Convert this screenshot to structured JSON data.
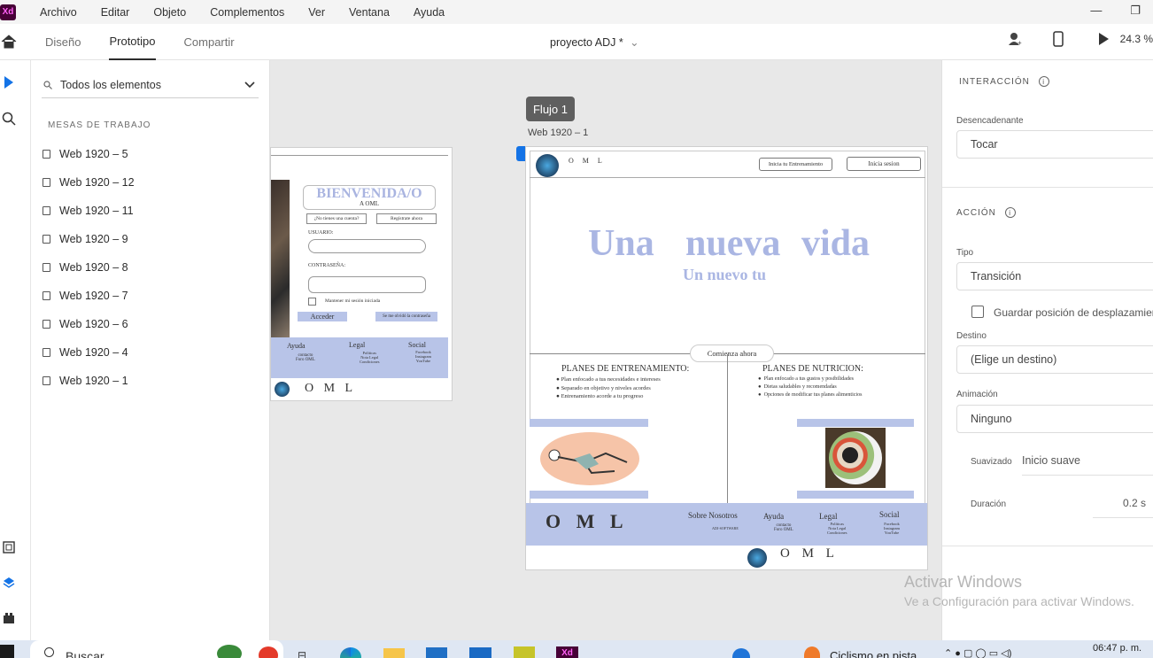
{
  "app": {
    "logo": "Xd",
    "menu": [
      "Archivo",
      "Editar",
      "Objeto",
      "Complementos",
      "Ver",
      "Ventana",
      "Ayuda"
    ]
  },
  "toolbar": {
    "tabs": [
      "Diseño",
      "Prototipo",
      "Compartir"
    ],
    "doc_title": "proyecto ADJ *",
    "zoom": "24.3 %"
  },
  "layers": {
    "search_label": "Todos los elementos",
    "section": "MESAS DE TRABAJO",
    "artboards": [
      "Web 1920 – 5",
      "Web 1920 – 12",
      "Web 1920 – 11",
      "Web 1920 – 9",
      "Web 1920 – 8",
      "Web 1920 – 7",
      "Web 1920 – 6",
      "Web 1920 – 4",
      "Web 1920 – 1"
    ]
  },
  "canvas": {
    "flow_label": "Flujo 1",
    "ab_label": "Web 1920 – 1",
    "login": {
      "welcome": "BIENVENIDA/O",
      "sub": "A OML",
      "no_account": "¿No tienes una cuenta?",
      "register": "Regístrate ahora",
      "user": "USUARIO:",
      "pass": "CONTRASEÑA:",
      "keep": "Mantener mi sesión iniciada",
      "access": "Acceder",
      "forgot": "Se me olvidó la contraseña",
      "footer_ayuda": "Ayuda",
      "footer_ayuda_items": "contacto\nForo OML",
      "footer_legal": "Legal",
      "footer_legal_items": "Políticas\nNota Legal\nCondiciones",
      "footer_social": "Social",
      "footer_social_items": "Facebook\nInstagram\nYouTube",
      "brand": "O M L"
    },
    "home": {
      "logo_text": "O M L",
      "btn1": "Inicia tu Entrenamiento",
      "btn2": "Inicia sesion",
      "hero1": "Una",
      "hero2": "nueva",
      "hero3": "vida",
      "hero_sub": "Un nuevo tu",
      "cta": "Comienza ahora",
      "plan1_title": "PLANES DE ENTRENAMIENTO:",
      "plan1_items": [
        "Plan enfocado a tus necesidades e intereses",
        "Separado en objetivo y  niveles acordes",
        "Entrenamiento acorde a tu progreso"
      ],
      "plan2_title": "PLANES DE NUTRICION:",
      "plan2_items": [
        "Plan enfocado a tus gustos y posibilidades",
        "Dietas saludables y recomendadas",
        "Opciones de modificar tus planes alimenticios"
      ],
      "footer_brand": "O M L",
      "about": "Sobre Nosotros",
      "about_sub": "ADJ-SOFTWARE",
      "ayuda": "Ayuda",
      "ayuda_items": "contacto\nForo OML",
      "legal": "Legal",
      "legal_items": "Políticas\nNota Legal\nCondiciones",
      "social": "Social",
      "social_items": "Facebook\nInstagram\nYouTube",
      "bottom_brand": "O M L"
    }
  },
  "props": {
    "interaction": "INTERACCIÓN",
    "trigger_label": "Desencadenante",
    "trigger_value": "Tocar",
    "action": "ACCIÓN",
    "type_label": "Tipo",
    "type_value": "Transición",
    "preserve": "Guardar posición de desplazamiento",
    "dest_label": "Destino",
    "dest_value": "(Elige un destino)",
    "anim_label": "Animación",
    "anim_value": "Ninguno",
    "ease_label": "Suavizado",
    "ease_value": "Inicio suave",
    "dur_label": "Duración",
    "dur_value": "0.2 s"
  },
  "watermark": {
    "line1": "Activar Windows",
    "line2": "Ve a Configuración para activar Windows."
  },
  "taskbar": {
    "search": "Buscar",
    "music": "Ciclismo en pista",
    "time": "06:47 p. m."
  },
  "colors": {
    "accent": "#1473e6",
    "lavender": "#b8c4e8",
    "hero": "#aab6e3"
  }
}
